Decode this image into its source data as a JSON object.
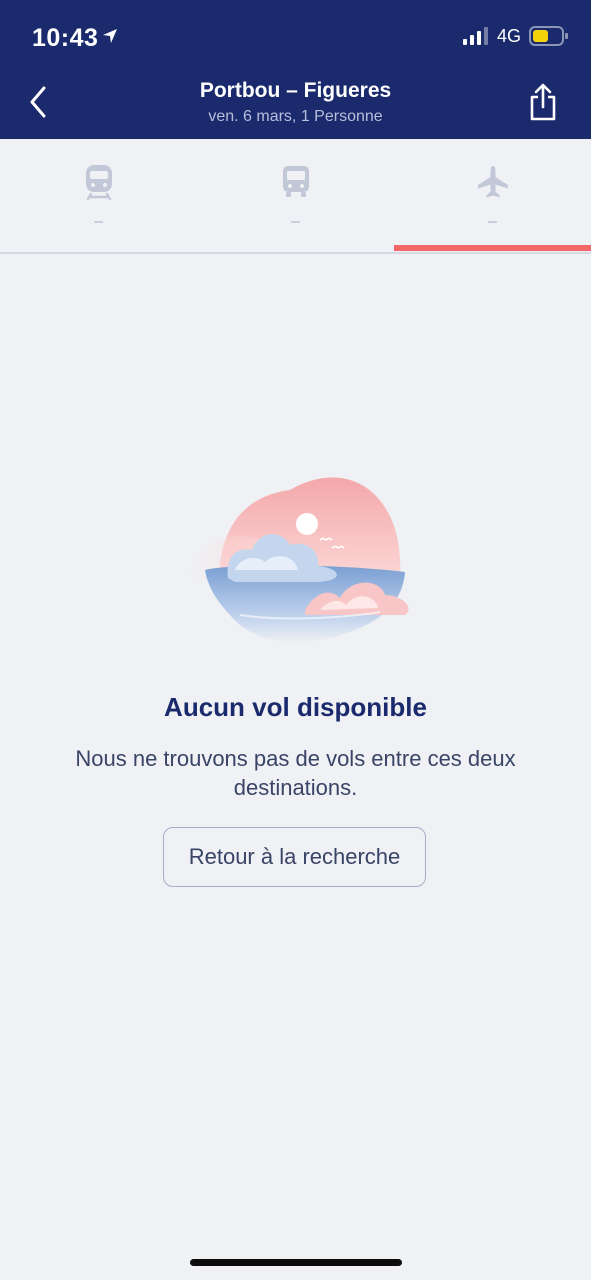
{
  "status_bar": {
    "time": "10:43",
    "network": "4G",
    "icons": [
      "location-arrow-icon",
      "signal-icon",
      "battery-icon"
    ]
  },
  "header": {
    "title": "Portbou – Figueres",
    "subtitle": "ven. 6 mars, 1 Personne",
    "icons": [
      "chevron-left-icon",
      "share-icon"
    ]
  },
  "tabs": [
    {
      "icon": "train-icon",
      "value": "–"
    },
    {
      "icon": "bus-icon",
      "value": "–"
    },
    {
      "icon": "plane-icon",
      "value": "–",
      "selected": true
    }
  ],
  "empty_state": {
    "title": "Aucun vol disponible",
    "description": "Nous ne trouvons pas de vols entre ces deux destinations.",
    "button_label": "Retour à la recherche"
  },
  "colors": {
    "header_bg": "#1a2a6c",
    "accent": "#f26767",
    "background": "#eff1f5",
    "battery": "#f5d20a"
  }
}
